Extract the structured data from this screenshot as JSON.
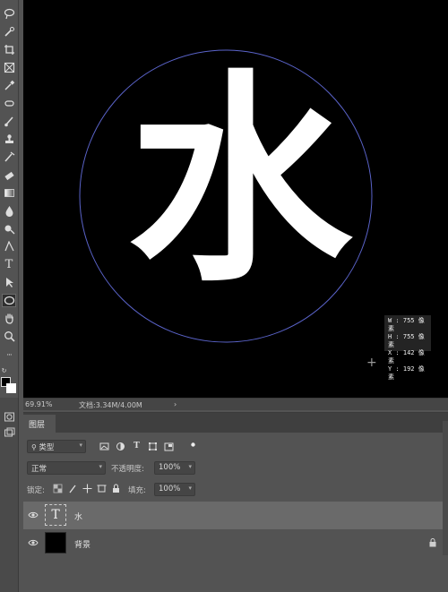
{
  "tools": [
    {
      "name": "lasso-icon",
      "glyph": ""
    },
    {
      "name": "quick-select-icon",
      "glyph": ""
    },
    {
      "name": "crop-icon",
      "glyph": ""
    },
    {
      "name": "frame-icon",
      "glyph": ""
    },
    {
      "name": "eyedropper-icon",
      "glyph": ""
    },
    {
      "name": "healing-brush-icon",
      "glyph": ""
    },
    {
      "name": "brush-icon",
      "glyph": ""
    },
    {
      "name": "stamp-icon",
      "glyph": ""
    },
    {
      "name": "history-brush-icon",
      "glyph": ""
    },
    {
      "name": "eraser-icon",
      "glyph": ""
    },
    {
      "name": "gradient-icon",
      "glyph": ""
    },
    {
      "name": "blur-icon",
      "glyph": ""
    },
    {
      "name": "dodge-icon",
      "glyph": ""
    },
    {
      "name": "pen-icon",
      "glyph": ""
    },
    {
      "name": "type-icon",
      "glyph": "T"
    },
    {
      "name": "path-select-icon",
      "glyph": ""
    },
    {
      "name": "ellipse-icon",
      "glyph": ""
    },
    {
      "name": "hand-icon",
      "glyph": ""
    },
    {
      "name": "zoom-icon",
      "glyph": ""
    },
    {
      "name": "more-tools-icon",
      "glyph": "···"
    }
  ],
  "canvas": {
    "glyph": "水",
    "readout": {
      "w": "W : 755 像素",
      "h": "H : 755 像素",
      "x": "X : 142 像素",
      "y": "Y : 192 像素"
    }
  },
  "status": {
    "zoom": "69.91%",
    "doc": "文档:3.34M/4.00M",
    "arrow": "›"
  },
  "layers_panel": {
    "tab": "图层",
    "filter_kind": "类型",
    "blend_mode": "正常",
    "opacity_label": "不透明度:",
    "opacity_value": "100%",
    "lock_label": "锁定:",
    "fill_label": "填充:",
    "fill_value": "100%",
    "layers": [
      {
        "name": "水",
        "thumb": "T",
        "selected": true
      },
      {
        "name": "背景",
        "thumb": "",
        "selected": false,
        "locked": true
      }
    ]
  },
  "colors": {
    "accent_selection": "#6a6a6a",
    "circle_stroke": "#5a63c9"
  }
}
